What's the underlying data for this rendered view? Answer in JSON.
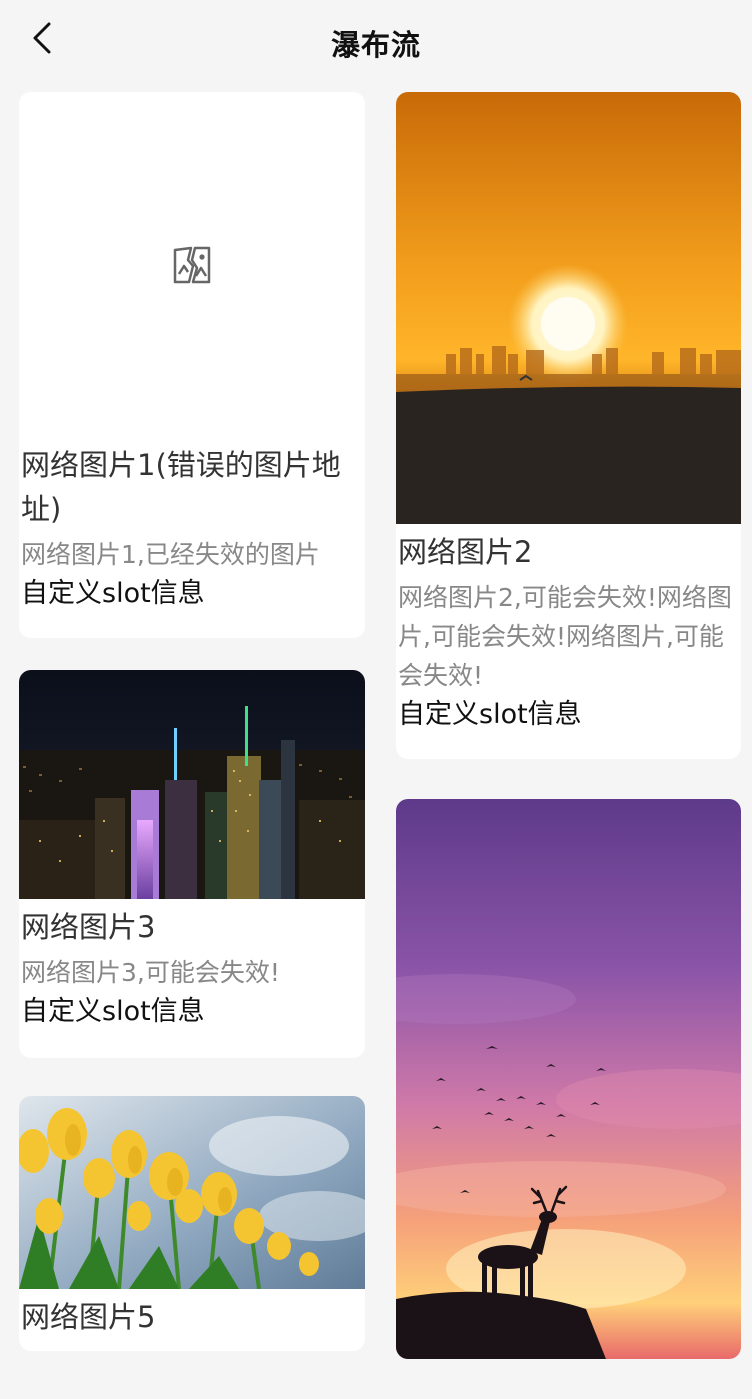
{
  "nav": {
    "title": "瀑布流",
    "back_icon": "chevron-left-icon"
  },
  "left": [
    {
      "title": "网络图片1(错误的图片地址)",
      "desc": "网络图片1,已经失效的图片",
      "slot": "自定义slot信息",
      "image": "broken-image-icon"
    },
    {
      "title": "网络图片3",
      "desc": "网络图片3,可能会失效!",
      "slot": "自定义slot信息",
      "image": "city-night-photo"
    },
    {
      "title": "网络图片5",
      "image": "yellow-tulips-photo"
    }
  ],
  "right": [
    {
      "title": "网络图片2",
      "desc": "网络图片2,可能会失效!网络图片,可能会失效!网络图片,可能会失效!",
      "slot": "自定义slot信息",
      "image": "sunset-city-photo"
    },
    {
      "image": "deer-sunset-photo"
    }
  ]
}
